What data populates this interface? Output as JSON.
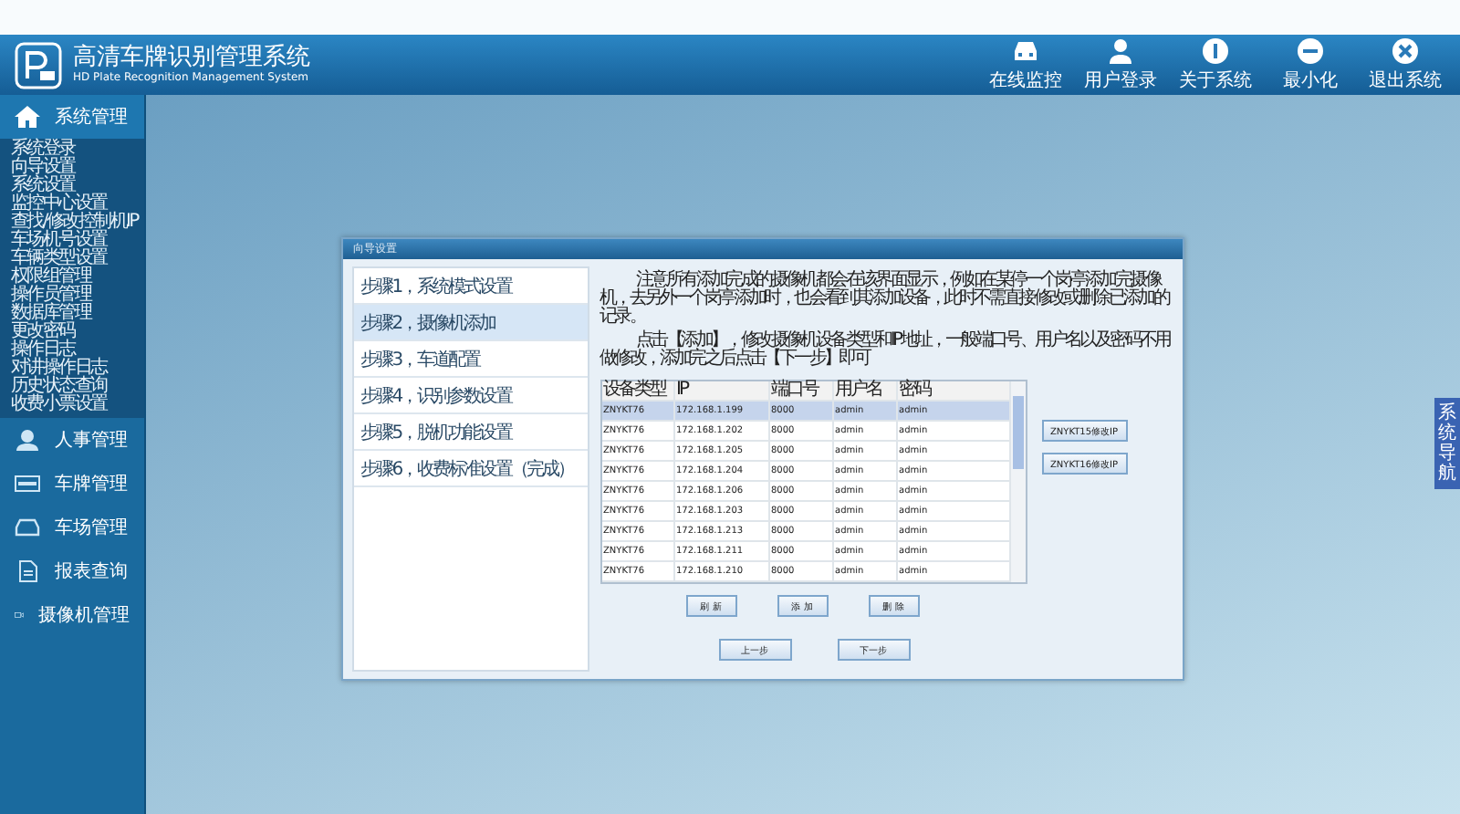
{
  "app": {
    "title": "高清车牌识别管理系统",
    "subtitle": "HD Plate Recognition Management System"
  },
  "toolbar": [
    {
      "label": "在线监控"
    },
    {
      "label": "用户登录"
    },
    {
      "label": "关于系统"
    },
    {
      "label": "最小化"
    },
    {
      "label": "退出系统"
    }
  ],
  "sidebar": {
    "sections": [
      {
        "label": "系统管理",
        "expanded": true,
        "children": [
          {
            "label": "系统登录"
          },
          {
            "label": "向导设置"
          },
          {
            "label": "系统设置"
          },
          {
            "label": "监控中心设置"
          },
          {
            "label": "查找/修改控制机IP"
          },
          {
            "label": "车场机号设置"
          },
          {
            "label": "车辆类型设置"
          },
          {
            "label": "权限组管理"
          },
          {
            "label": "操作员管理"
          },
          {
            "label": "数据库管理"
          },
          {
            "label": "更改密码"
          },
          {
            "label": "操作日志"
          },
          {
            "label": "对讲操作日志"
          },
          {
            "label": "历史状态查询"
          },
          {
            "label": "收费小票设置"
          }
        ]
      },
      {
        "label": "人事管理",
        "expanded": false
      },
      {
        "label": "车牌管理",
        "expanded": false
      },
      {
        "label": "车场管理",
        "expanded": false
      },
      {
        "label": "报表查询",
        "expanded": false
      },
      {
        "label": "摄像机管理",
        "expanded": false
      }
    ]
  },
  "dialog": {
    "title": "向导设置",
    "steps": [
      {
        "label": "步骤1，系统模式设置",
        "selected": false
      },
      {
        "label": "步骤2，摄像机添加",
        "selected": true
      },
      {
        "label": "步骤3，车道配置",
        "selected": false
      },
      {
        "label": "步骤4，识别参数设置",
        "selected": false
      },
      {
        "label": "步骤5，脱机功能设置",
        "selected": false
      },
      {
        "label": "步骤6，收费标准设置（完成）",
        "selected": false
      }
    ],
    "notes": [
      "注意所有添加完成的摄像机都会在该界面显示，例如在某停一个岗亭添加完摄像机，去另外一个岗亭添加时，也会看到其添加设备，此时不需直接修改或删除已添加的记录。",
      "点击【添加】，修改摄像机设备类型和IP地址，一般端口号、用户名以及密码不用做修改，添加完之后点击【下一步】即可"
    ],
    "table": {
      "columns": [
        "设备类型",
        "IP",
        "端口号",
        "用户名",
        "密码"
      ],
      "rows": [
        {
          "cells": [
            "ZNYKT76",
            "172.168.1.199",
            "8000",
            "admin",
            "admin"
          ],
          "selected": true
        },
        {
          "cells": [
            "ZNYKT76",
            "172.168.1.202",
            "8000",
            "admin",
            "admin"
          ],
          "selected": false
        },
        {
          "cells": [
            "ZNYKT76",
            "172.168.1.205",
            "8000",
            "admin",
            "admin"
          ],
          "selected": false
        },
        {
          "cells": [
            "ZNYKT76",
            "172.168.1.204",
            "8000",
            "admin",
            "admin"
          ],
          "selected": false
        },
        {
          "cells": [
            "ZNYKT76",
            "172.168.1.206",
            "8000",
            "admin",
            "admin"
          ],
          "selected": false
        },
        {
          "cells": [
            "ZNYKT76",
            "172.168.1.203",
            "8000",
            "admin",
            "admin"
          ],
          "selected": false
        },
        {
          "cells": [
            "ZNYKT76",
            "172.168.1.213",
            "8000",
            "admin",
            "admin"
          ],
          "selected": false
        },
        {
          "cells": [
            "ZNYKT76",
            "172.168.1.211",
            "8000",
            "admin",
            "admin"
          ],
          "selected": false
        },
        {
          "cells": [
            "ZNYKT76",
            "172.168.1.210",
            "8000",
            "admin",
            "admin"
          ],
          "selected": false
        }
      ]
    },
    "side_buttons": [
      "ZNYKT15修改IP",
      "ZNYKT16修改IP"
    ],
    "actions": [
      "刷 新",
      "添 加",
      "删 除"
    ],
    "nav_buttons": [
      "上一步",
      "下一步"
    ]
  },
  "side_tab": "系统导航"
}
